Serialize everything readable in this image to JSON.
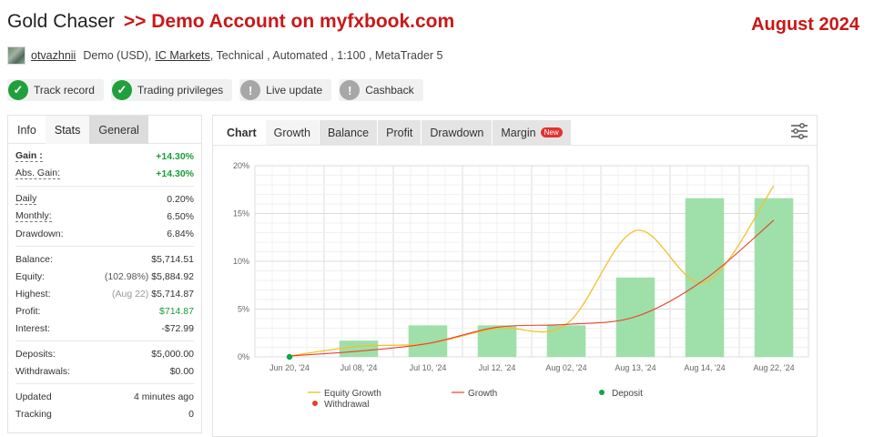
{
  "header": {
    "title": "Gold Chaser",
    "demo_text": ">> Demo Account on myfxbook.com",
    "month": "August 2024"
  },
  "meta": {
    "username": "otvazhnii",
    "account_type": "Demo (USD),",
    "broker": "IC Markets",
    "details": ", Technical , Automated , 1:100 , MetaTrader 5"
  },
  "badges": [
    {
      "label": "Track record",
      "status": "ok",
      "icon": "check-icon"
    },
    {
      "label": "Trading privileges",
      "status": "ok",
      "icon": "check-icon"
    },
    {
      "label": "Live update",
      "status": "na",
      "icon": "exclamation-icon"
    },
    {
      "label": "Cashback",
      "status": "na",
      "icon": "exclamation-icon"
    }
  ],
  "left_tabs": [
    "Info",
    "Stats",
    "General"
  ],
  "stats": {
    "gain_label": "Gain :",
    "gain": "+14.30%",
    "abs_gain_label": "Abs. Gain:",
    "abs_gain": "+14.30%",
    "daily_label": "Daily",
    "daily": "0.20%",
    "monthly_label": "Monthly:",
    "monthly": "6.50%",
    "drawdown_label": "Drawdown:",
    "drawdown": "6.84%",
    "balance_label": "Balance:",
    "balance": "$5,714.51",
    "equity_label": "Equity:",
    "equity_pct": "(102.98%)",
    "equity": "$5,884.92",
    "highest_label": "Highest:",
    "highest_date": "(Aug 22)",
    "highest": "$5,714.87",
    "profit_label": "Profit:",
    "profit": "$714.87",
    "interest_label": "Interest:",
    "interest": "-$72.99",
    "deposits_label": "Deposits:",
    "deposits": "$5,000.00",
    "withdrawals_label": "Withdrawals:",
    "withdrawals": "$0.00",
    "updated_label": "Updated",
    "updated": "4 minutes ago",
    "tracking_label": "Tracking",
    "tracking": "0"
  },
  "chart_tabs": [
    "Chart",
    "Growth",
    "Balance",
    "Profit",
    "Drawdown",
    "Margin"
  ],
  "chart_new_badge": "New",
  "colors": {
    "accent_red": "#c91818",
    "ok_green": "#20a03c",
    "bar_green": "#9fdfaa",
    "equity_line": "#f2c12e",
    "growth_line": "#e8412c",
    "deposit_dot": "#16a34a",
    "withdrawal_dot": "#e8412c"
  },
  "chart_data": {
    "type": "bar",
    "categories": [
      "Jun 20, '24",
      "Jul 08, '24",
      "Jul 10, '24",
      "Jul 12, '24",
      "Aug 02, '24",
      "Aug 13, '24",
      "Aug 14, '24",
      "Aug 22, '24"
    ],
    "yticks": [
      "0%",
      "5%",
      "10%",
      "15%",
      "20%"
    ],
    "ylim": [
      0,
      20
    ],
    "series": [
      {
        "name": "Bars",
        "type": "bar",
        "values": [
          0,
          1.7,
          3.3,
          3.3,
          3.3,
          8.3,
          16.6,
          16.6
        ]
      },
      {
        "name": "Equity Growth",
        "type": "line",
        "values": [
          0.1,
          1.1,
          1.4,
          3.0,
          3.4,
          13.2,
          7.8,
          17.9
        ]
      },
      {
        "name": "Growth",
        "type": "line",
        "values": [
          0.1,
          0.6,
          1.4,
          3.1,
          3.4,
          4.2,
          8.1,
          14.3
        ]
      }
    ],
    "deposit_points": [
      {
        "x": "Jun 20, '24",
        "y": 0
      }
    ],
    "legend": [
      "Equity Growth",
      "Growth",
      "Deposit",
      "Withdrawal"
    ],
    "legend_position": "bottom"
  }
}
